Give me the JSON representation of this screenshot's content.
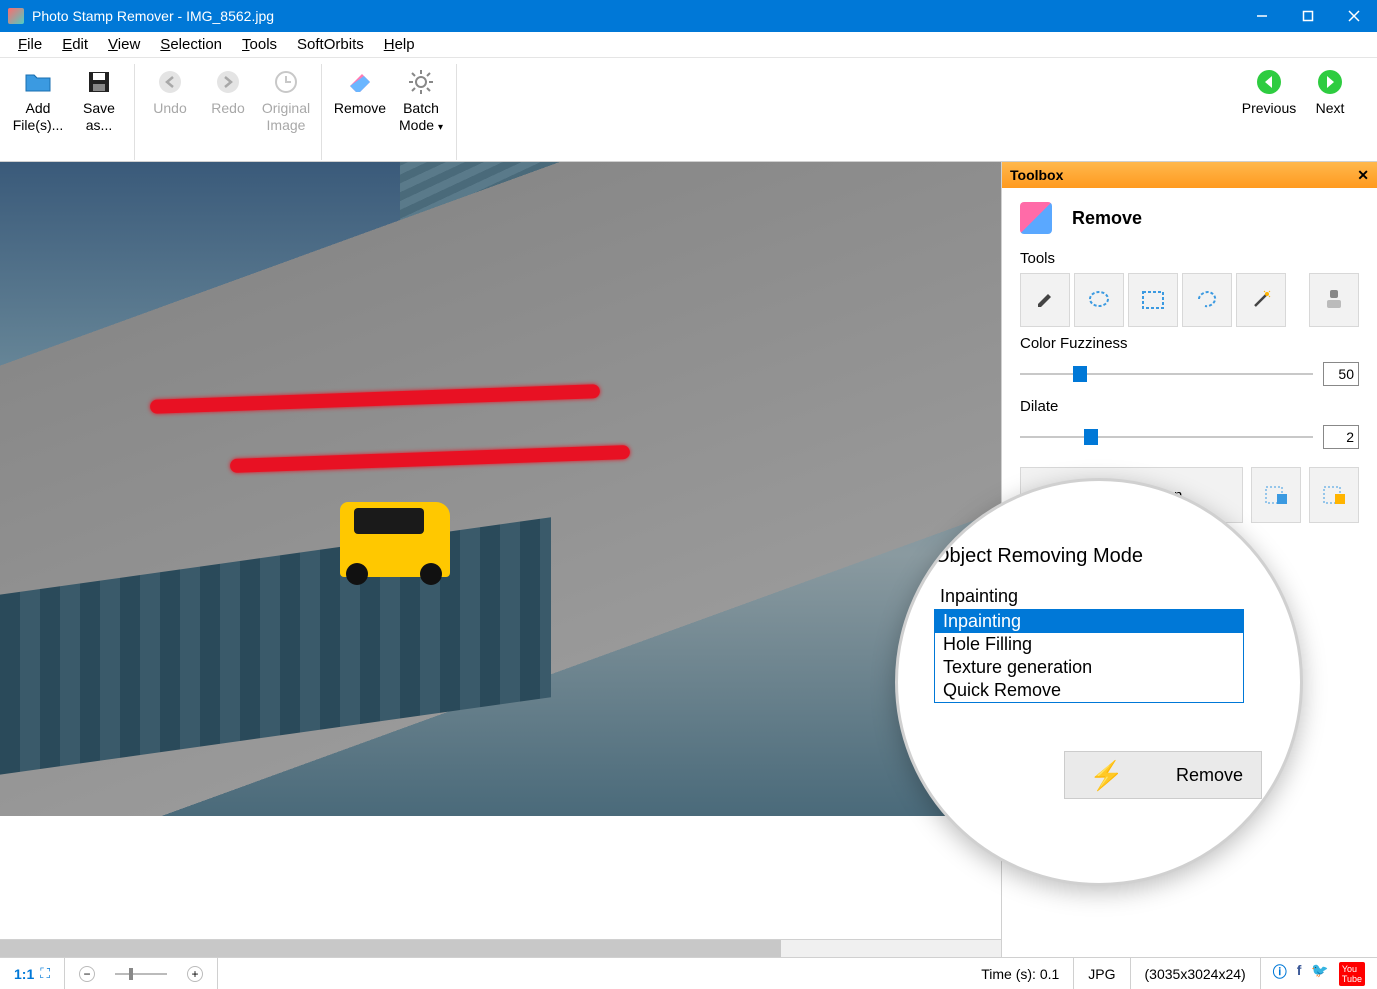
{
  "titlebar": {
    "app": "Photo Stamp Remover",
    "file": "IMG_8562.jpg"
  },
  "menubar": [
    "File",
    "Edit",
    "View",
    "Selection",
    "Tools",
    "SoftOrbits",
    "Help"
  ],
  "toolbar": {
    "add_files": "Add File(s)...",
    "save_as": "Save as...",
    "undo": "Undo",
    "redo": "Redo",
    "original": "Original Image",
    "remove": "Remove",
    "batch": "Batch Mode",
    "previous": "Previous",
    "next": "Next"
  },
  "toolbox": {
    "title": "Toolbox",
    "header": "Remove",
    "tools_label": "Tools",
    "fuzziness_label": "Color Fuzziness",
    "fuzziness_value": "50",
    "dilate_label": "Dilate",
    "dilate_value": "2",
    "clear_selection": "Clear Selection",
    "object_removing_mode": "Object Removing Mode",
    "selected_mode": "Inpainting",
    "modes": [
      "Inpainting",
      "Hole Filling",
      "Texture generation",
      "Quick Remove"
    ],
    "remove_button": "Remove"
  },
  "statusbar": {
    "zoom_label": "1:1",
    "time": "Time (s): 0.1",
    "format": "JPG",
    "dimensions": "(3035x3024x24)"
  }
}
